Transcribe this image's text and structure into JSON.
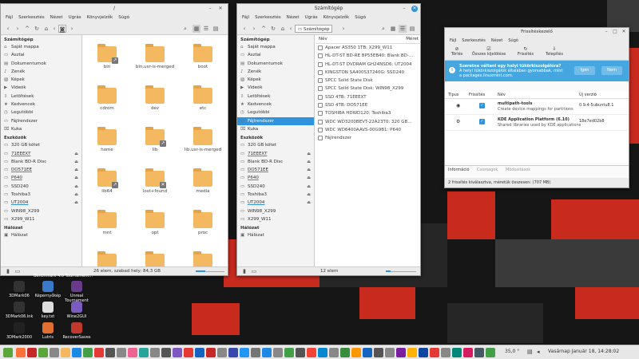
{
  "fm1": {
    "title": "/",
    "menu": [
      "Fájl",
      "Szerkesztés",
      "Nézet",
      "Ugrás",
      "Könyvjelzők",
      "Súgó"
    ],
    "places_header": "Számítógép",
    "places": [
      "Saját mappa",
      "Asztal",
      "Dokumentumok",
      "Zenék",
      "Képek",
      "Videók",
      "Letöltések",
      "Kedvencek",
      "Legutóbbi",
      "Fájlrendszer",
      "Kuka"
    ],
    "devices_header": "Eszközök",
    "devices": [
      "320 GB kötet",
      "71EEEXT",
      "Blank BD-R Disc",
      "DO571EE",
      "P640",
      "SSD240",
      "Toshiba3",
      "UT2004",
      "WIN98_X299",
      "X299_W11"
    ],
    "network_header": "Hálózat",
    "network": [
      "Hálózat"
    ],
    "files": [
      "bin",
      "bin.usr-is-merged",
      "boot",
      "cdrom",
      "dev",
      "etc",
      "home",
      "lib",
      "lib.usr-is-merged",
      "lib64",
      "lost+found",
      "media",
      "mnt",
      "opt",
      "proc",
      "",
      "",
      ""
    ],
    "status": "26 elem, szabad hely: 84,3 GB"
  },
  "fm2": {
    "title": "Számítógép",
    "menu": [
      "Fájl",
      "Szerkesztés",
      "Nézet",
      "Ugrás",
      "Könyvjelzők",
      "Súgó"
    ],
    "breadcrumb": "Számítógép",
    "places_header": "Számítógép",
    "places": [
      "Saját mappa",
      "Asztal",
      "Dokumentumok",
      "Zenék",
      "Képek",
      "Videók",
      "Letöltések",
      "Kedvencek",
      "Legutóbbi",
      "Fájlrendszer",
      "Kuka"
    ],
    "devices_header": "Eszközök",
    "devices": [
      "320 GB kötet",
      "71EEEXT",
      "Blank BD-R Disc",
      "DO571EE",
      "P640",
      "SSD240",
      "Toshiba3",
      "UT2004",
      "WIN98_X299",
      "X299_W11"
    ],
    "network_header": "Hálózat",
    "network": [
      "Hálózat"
    ],
    "col_name": "Név",
    "col_size": "Méret",
    "rows": [
      "Apacer AS350 1TB: X299_W11",
      "HL-DT-ST BD-RE BP55EB40: Blank BD-...",
      "HL-DT-ST DVDRAM GH24NSD6: UT2004",
      "KINGSTON SA400S37240G: SSD240",
      "SPCC Solid State Disk",
      "SPCC Solid State Disk: WIN98_X299",
      "SSD 4TB: 71EEEXT",
      "SSD 4TB: DO571EE",
      "TOSHIBA HDWD120: Toshiba3",
      "WDC WD3200BEVT-22A23T0: 320 GB...",
      "WDC WD6400AAVS-00G9B1: P640",
      "Fájlrendszer"
    ],
    "status": "12 elem"
  },
  "upd": {
    "title": "Frissítéskezelő",
    "menu": [
      "Fájl",
      "Szerkesztés",
      "Nézet",
      "Súgó"
    ],
    "tools": [
      "Törlés",
      "Összes kijelölése",
      "Frissítés",
      "Telepítés"
    ],
    "banner": "Szeretne váltani egy helyi tükörkiszolgálóra?",
    "banner_sub": "A helyi tükörkiszolgálók általában gyorsabbak, mint a packages.linuxmint.com.",
    "banner_yes": "Igen",
    "banner_no": "Nem",
    "cols": [
      "Típus",
      "Frissítés",
      "Név",
      "Új verzió"
    ],
    "items": [
      {
        "name": "multipath-tools",
        "desc": "Create device mappings for partitions",
        "ver": "0.9.4-5ubuntu8.1"
      },
      {
        "name": "KDE Application Platform (6.10)",
        "desc": "Shared libraries used by KDE applications",
        "ver": "18e7ed02b8"
      }
    ],
    "tabs": [
      "Információ",
      "Csomagok",
      "Módosítások"
    ],
    "status": "2 frissítés kiválasztva, méretük összesen: (707 MB)"
  },
  "desktop": {
    "icons": [
      "3DMark06",
      "Képernyőkép",
      "Unreal Tournament",
      "3DMark06.lnk",
      "key.txt",
      "Wine2GUI",
      "3DMark2000",
      "Lutris",
      "RecoverSaves"
    ],
    "notif": "Benchmark 4.0 Tournament..."
  },
  "taskbar": {
    "temp": "35,0 °",
    "clock": "Vasárnap Január 18, 14:28:02"
  }
}
